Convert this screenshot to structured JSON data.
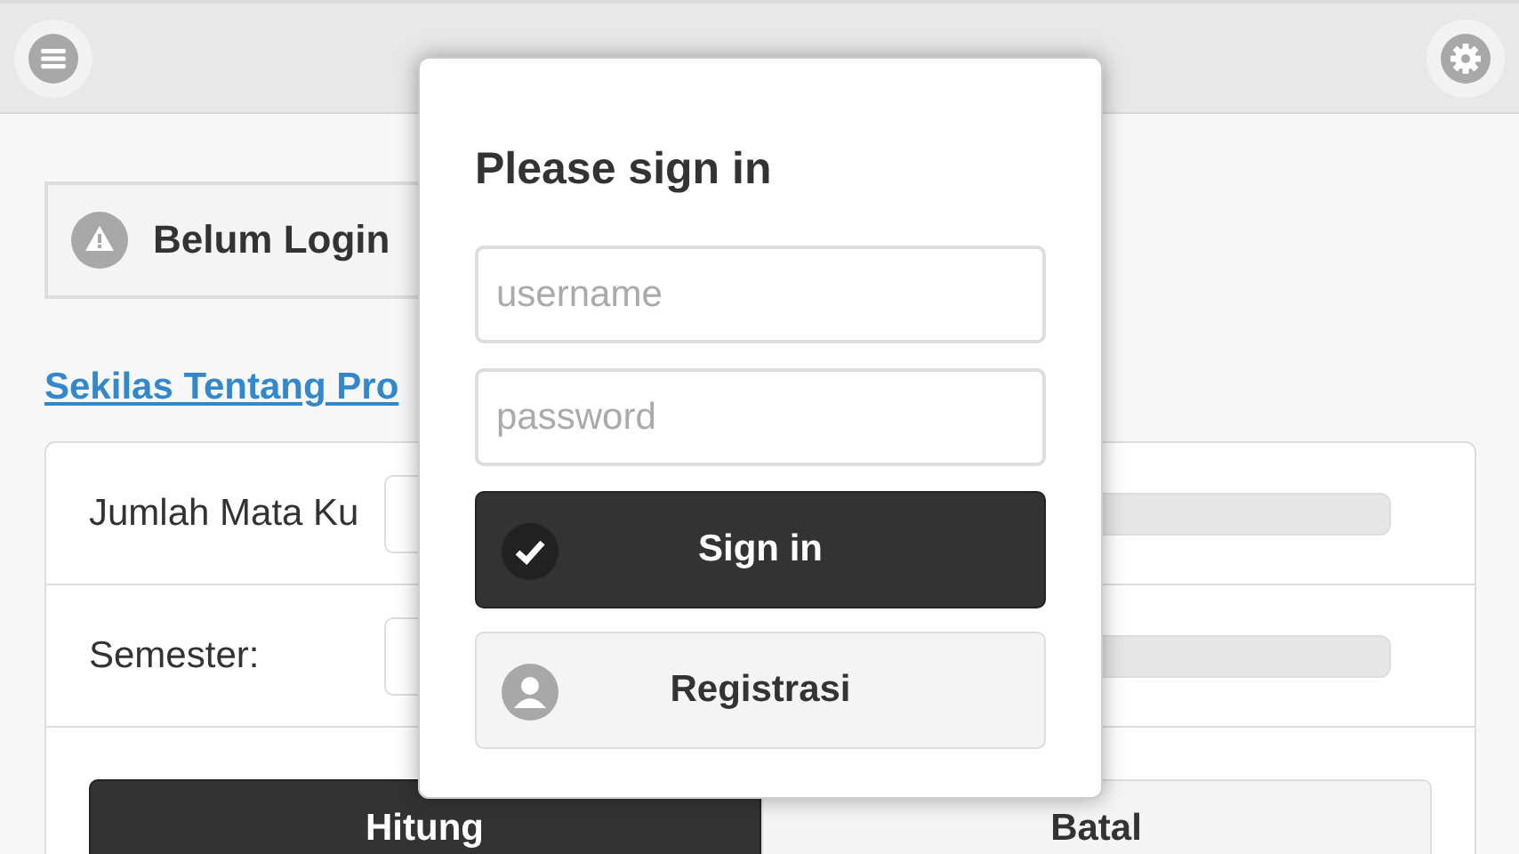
{
  "status": {
    "label": "Belum Login"
  },
  "about_link": {
    "label": "Sekilas Tentang Pro"
  },
  "form": {
    "rows": [
      {
        "label": "Jumlah Mata Ku"
      },
      {
        "label": "Semester:"
      }
    ],
    "buttons": [
      {
        "label": "Hitung",
        "kind": "primary"
      },
      {
        "label": "Batal",
        "kind": "secondary"
      }
    ]
  },
  "popup": {
    "title": "Please sign in",
    "username": {
      "placeholder": "username"
    },
    "password": {
      "placeholder": "password"
    },
    "buttons": [
      {
        "label": "Sign in",
        "kind": "primary"
      },
      {
        "label": "Registrasi",
        "kind": "secondary"
      }
    ]
  }
}
